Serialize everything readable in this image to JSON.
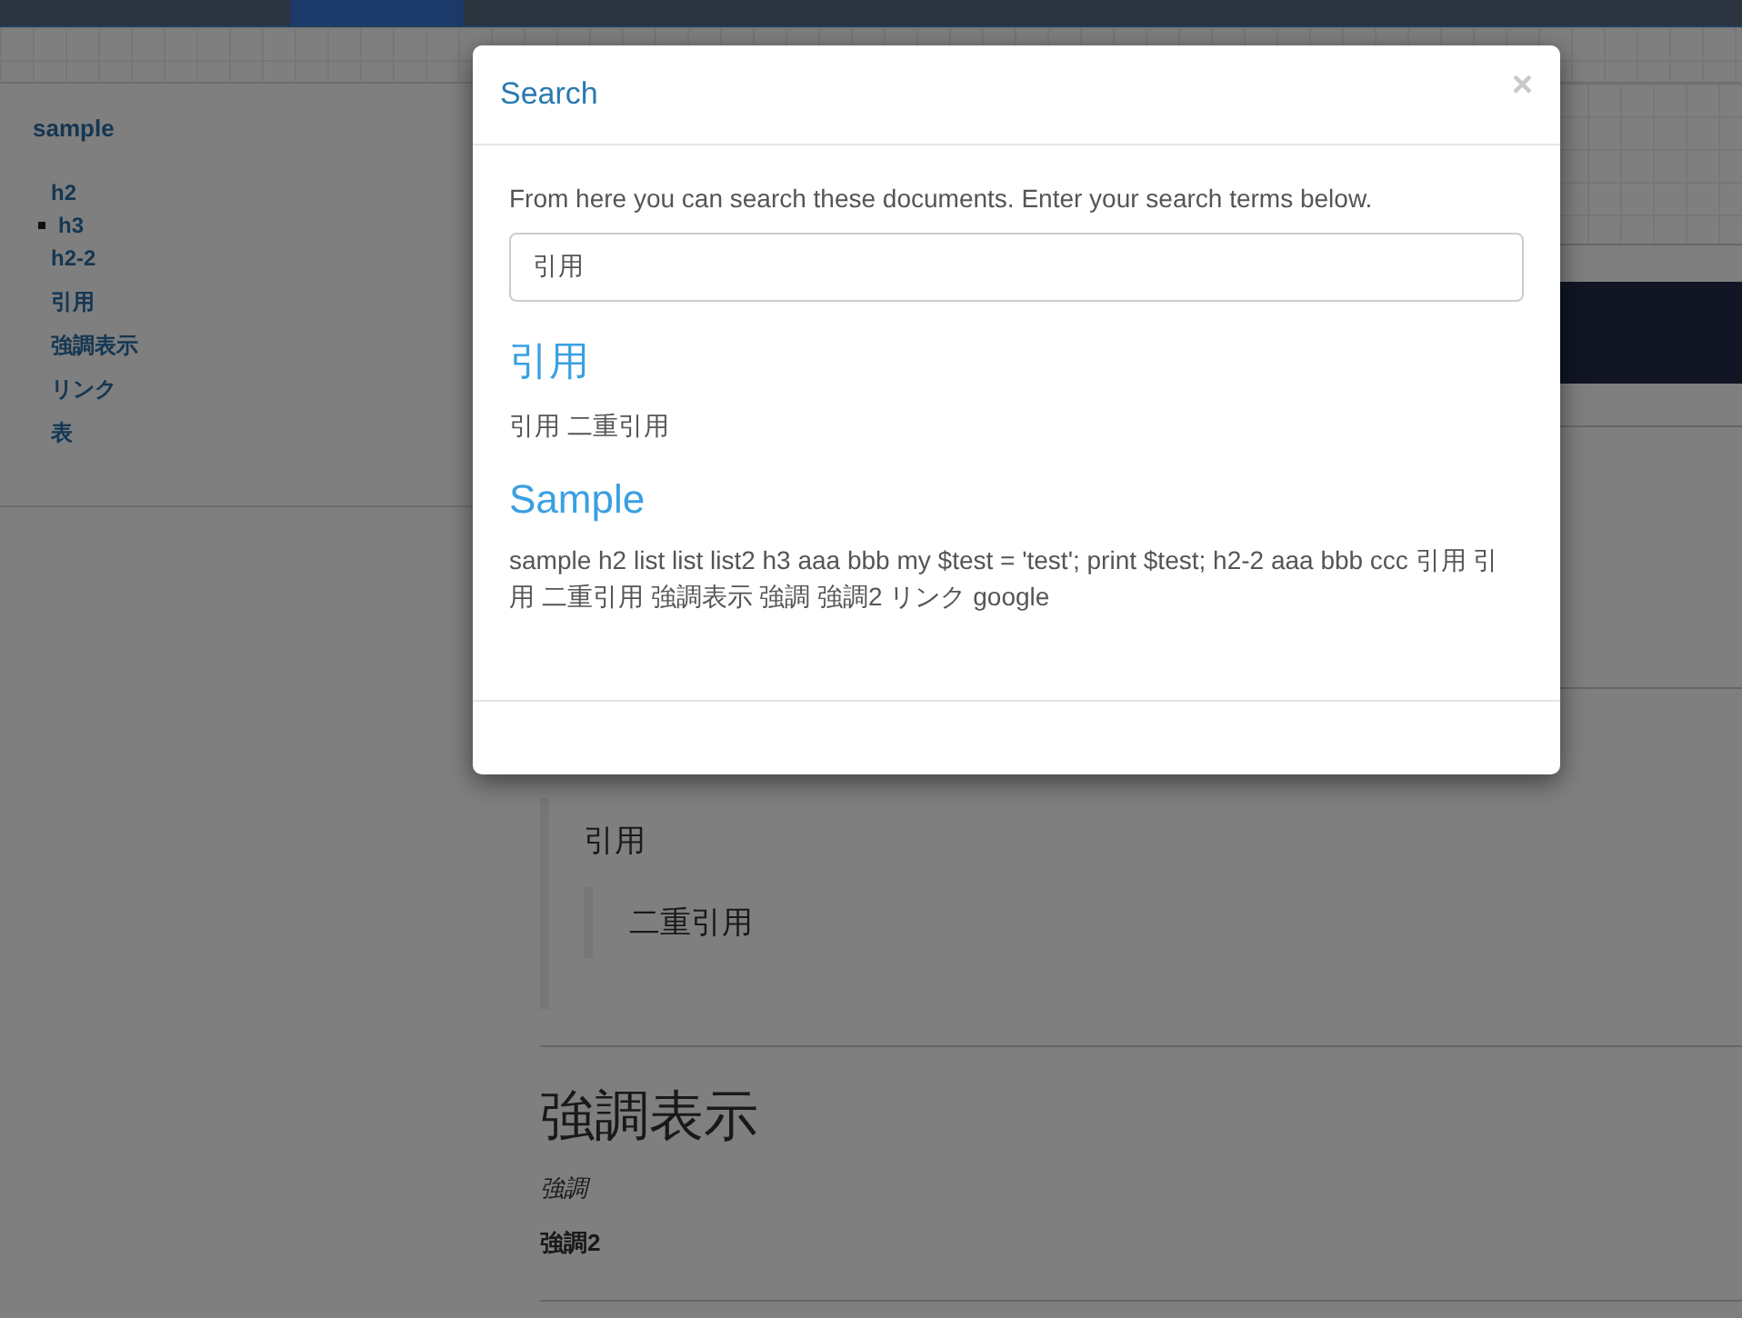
{
  "sidebar": {
    "title": "sample",
    "items": [
      {
        "label": "h2",
        "children": [
          {
            "label": "h3"
          }
        ]
      },
      {
        "label": "h2-2"
      },
      {
        "label": "引用"
      },
      {
        "label": "強調表示"
      },
      {
        "label": "リンク"
      },
      {
        "label": "表"
      }
    ]
  },
  "content": {
    "quote": "引用",
    "nested_quote": "二重引用",
    "heading": "強調表示",
    "emphasis": "強調",
    "strong": "強調2"
  },
  "modal": {
    "title": "Search",
    "close": "×",
    "intro": "From here you can search these documents. Enter your search terms below.",
    "search_value": "引用",
    "results": [
      {
        "title": "引用",
        "excerpt": "引用 二重引用"
      },
      {
        "title": "Sample",
        "excerpt": "sample h2 list list list2 h3 aaa bbb my $test = 'test'; print $test; h2-2 aaa bbb ccc 引用 引用 二重引用 強調表示 強調 強調2 リンク google"
      }
    ]
  }
}
